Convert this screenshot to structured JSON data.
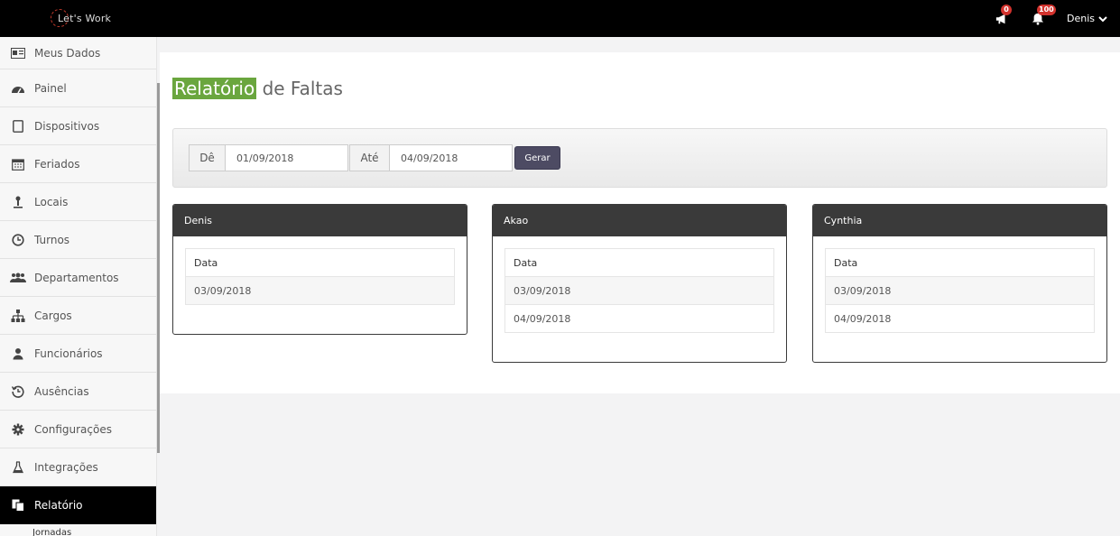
{
  "brand": {
    "name": "Let's Work"
  },
  "topbar": {
    "announcements_count": "0",
    "notifications_count": "100",
    "user_name": "Denis"
  },
  "sidebar": {
    "items": [
      {
        "label": "Meus Dados",
        "icon": "id-card-icon"
      },
      {
        "label": "Painel",
        "icon": "dashboard-icon"
      },
      {
        "label": "Dispositivos",
        "icon": "tablet-icon"
      },
      {
        "label": "Feriados",
        "icon": "calendar-icon"
      },
      {
        "label": "Locais",
        "icon": "location-icon"
      },
      {
        "label": "Turnos",
        "icon": "clock-icon"
      },
      {
        "label": "Departamentos",
        "icon": "users-icon"
      },
      {
        "label": "Cargos",
        "icon": "sitemap-icon"
      },
      {
        "label": "Funcionários",
        "icon": "user-icon"
      },
      {
        "label": "Ausências",
        "icon": "history-icon"
      },
      {
        "label": "Configurações",
        "icon": "cog-icon"
      },
      {
        "label": "Integrações",
        "icon": "flask-icon"
      },
      {
        "label": "Relatório",
        "icon": "copy-icon"
      }
    ],
    "sub_item": "Jornadas"
  },
  "page": {
    "title_highlight": "Relatório",
    "title_rest": " de Faltas"
  },
  "filter": {
    "from_label": "Dê",
    "from_value": "01/09/2018",
    "to_label": "Até",
    "to_value": "04/09/2018",
    "submit_label": "Gerar"
  },
  "cards": [
    {
      "name": "Denis",
      "header": "Data",
      "dates": [
        "03/09/2018"
      ]
    },
    {
      "name": "Akao",
      "header": "Data",
      "dates": [
        "03/09/2018",
        "04/09/2018"
      ]
    },
    {
      "name": "Cynthia",
      "header": "Data",
      "dates": [
        "03/09/2018",
        "04/09/2018"
      ]
    }
  ]
}
